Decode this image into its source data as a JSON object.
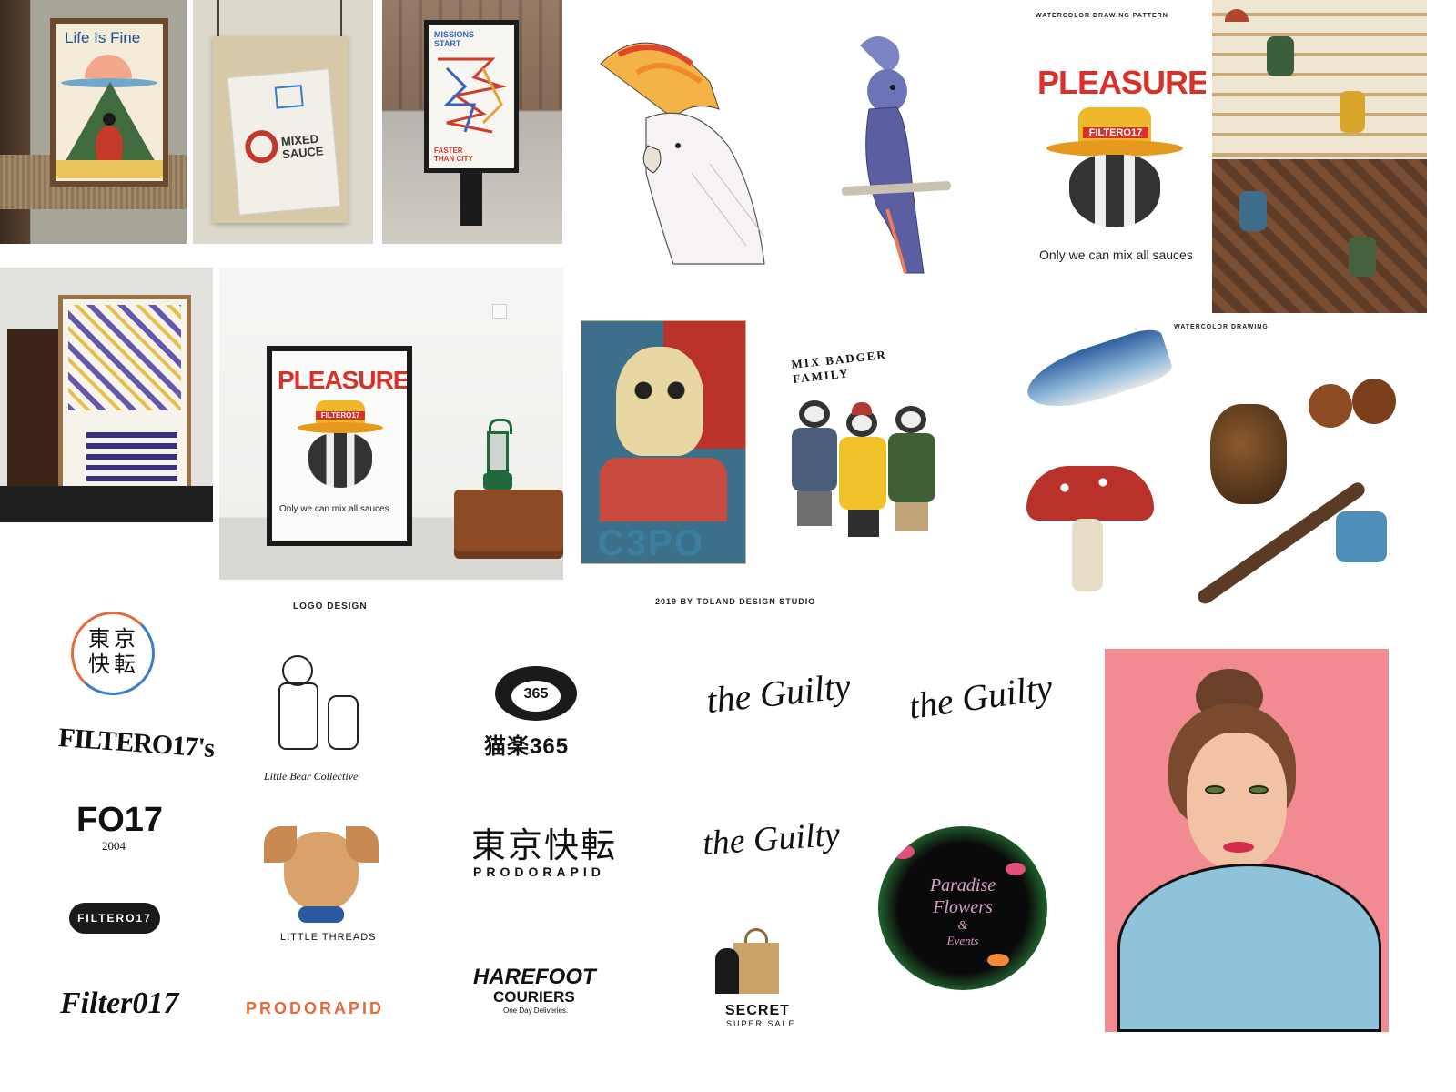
{
  "posters": {
    "life_is_fine": "Life Is Fine",
    "mixed_sauce": "MIXED SAUCE",
    "missions_start": "MISSIONS START",
    "faster_than_city": "FASTER THAN CITY"
  },
  "captions": {
    "watercolor_pattern": "WATERCOLOR DRAWING PATTERN",
    "watercolor_drawing": "WATERCOLOR DRAWING",
    "logo_design": "LOGO DESIGN",
    "studio_credit": "2019 BY TOLAND DESIGN STUDIO"
  },
  "pleasure_poster": {
    "headline": "PLEASURE!",
    "hat_text": "FILTERO17",
    "tagline": "Only we can mix all sauces"
  },
  "c3po_poster": {
    "label": "C3PO"
  },
  "badger_family": {
    "title": "MIX BADGER FAMILY"
  },
  "logos": {
    "tokyo_cn": "東京快転",
    "filter017s": "FILTERO17's",
    "f017": "FO17",
    "f017_year": "2004",
    "filter017_pill": "FILTERO17",
    "filter017_script": "Filter017",
    "little_bear": "Little Bear Collective",
    "little_threads": "LITTLE THREADS",
    "prodorapid_color": "PRODORAPID",
    "badge_365": "365",
    "cn_365": "猫楽365",
    "prodorapid_cn": "東京快転",
    "prodorapid_bw": "PRODORAPID",
    "harefoot": "HAREFOOT",
    "couriers": "COURIERS",
    "one_day": "One Day Deliveries.",
    "the_guilty": "the Guilty",
    "secret": "SECRET",
    "super_sale": "SUPER SALE",
    "paradise_1": "Paradise",
    "paradise_2": "Flowers",
    "paradise_3": "&",
    "paradise_4": "Events"
  },
  "colors": {
    "pleasure_red": "#d8312a",
    "hat_yellow": "#f0b72a",
    "portrait_pink": "#f28a92",
    "jacket_blue": "#8fc3dc"
  }
}
